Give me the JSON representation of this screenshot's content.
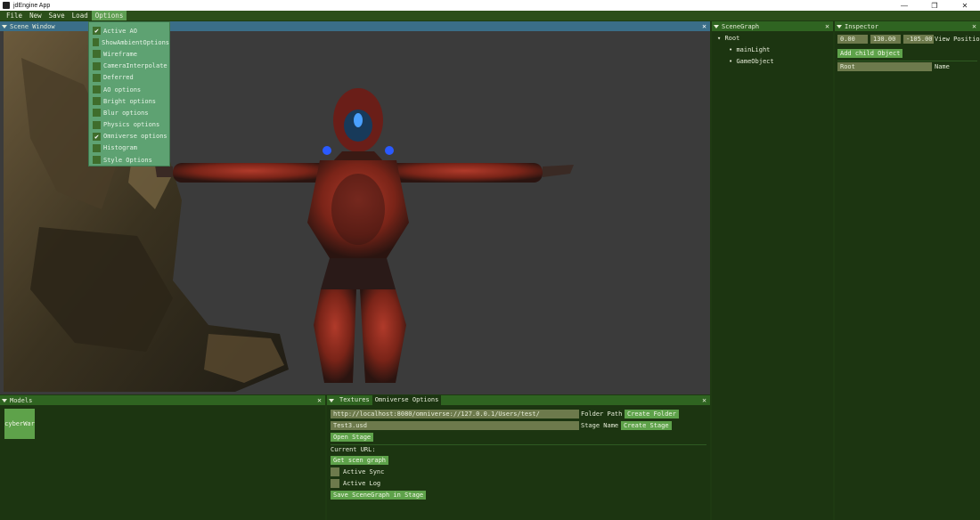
{
  "app": {
    "title": "jdEngine App"
  },
  "window_buttons": {
    "minimize": "—",
    "restore": "❐",
    "close": "✕"
  },
  "menu": {
    "items": [
      "File",
      "New",
      "Save",
      "Load",
      "Options"
    ]
  },
  "options_menu": {
    "items": [
      {
        "label": "Active AO",
        "checked": true
      },
      {
        "label": "ShowAmbientOptions",
        "checked": false
      },
      {
        "label": "Wireframe",
        "checked": false
      },
      {
        "label": "CameraInterpolate",
        "checked": false
      },
      {
        "label": "Deferred",
        "checked": false
      },
      {
        "label": "AO options",
        "checked": false
      },
      {
        "label": "Bright options",
        "checked": false
      },
      {
        "label": "Blur options",
        "checked": false
      },
      {
        "label": "Physics options",
        "checked": false
      },
      {
        "label": "Omniverse options",
        "checked": true
      },
      {
        "label": "Histogram",
        "checked": false
      },
      {
        "label": "Style Options",
        "checked": false
      }
    ]
  },
  "scene_window": {
    "title": "Scene Window"
  },
  "scenegraph": {
    "title": "SceneGraph",
    "root": "Root",
    "children": [
      "mainLight",
      "GameObject"
    ]
  },
  "inspector": {
    "title": "Inspector",
    "pos_x": "0.00",
    "pos_y": "130.00",
    "pos_z": "-105.00",
    "view_position_label": "View Positio",
    "add_child_label": "Add child Object",
    "name_value": "Root",
    "name_label": "Name"
  },
  "models": {
    "title": "Models",
    "item": "cyberWar"
  },
  "bottom_tabs": {
    "textures": "Textures",
    "omniverse": "Omniverse Options"
  },
  "omniverse": {
    "folder_path_value": "http://localhost:8080/omniverse://127.0.0.1/Users/test/",
    "folder_path_label": "Folder Path",
    "create_folder_label": "Create Folder",
    "stage_name_value": "Test3.usd",
    "stage_name_label": "Stage Name",
    "create_stage_label": "Create Stage",
    "open_stage_label": "Open Stage",
    "current_url_label": "Current URL:",
    "get_scene_graph_label": "Get scen graph",
    "active_sync_label": "Active Sync",
    "active_log_label": "Active Log",
    "save_scenegraph_label": "Save SceneGraph in Stage"
  },
  "colors": {
    "accent": "#2f6421",
    "panel_bg": "#1c3511",
    "button": "#5ea24a",
    "menu_active": "#5e9e52",
    "scene_header": "#3a6e88"
  },
  "icons": {
    "collapse": "triangle-down-icon",
    "close": "close-icon",
    "check": "check-icon"
  }
}
